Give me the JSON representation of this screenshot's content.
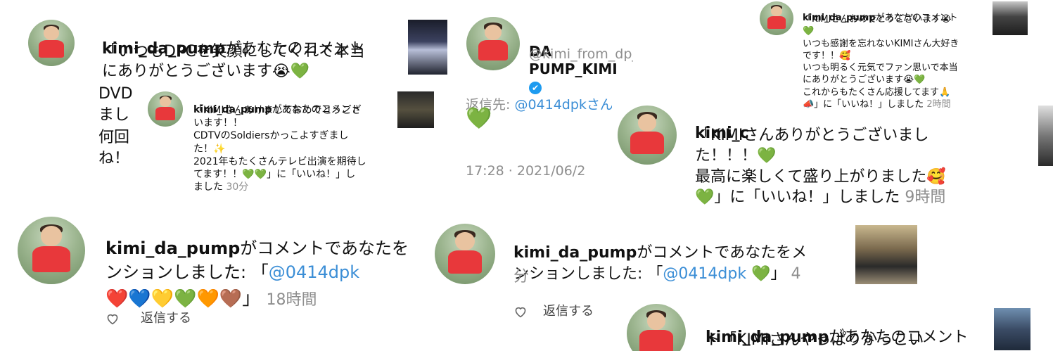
{
  "card1": {
    "username": "kimi_da_pump",
    "line1_rest": "があなたのコメント",
    "line2": "「いつもDPCを笑顔にしてくれて本当",
    "line3": "にありがとうございます😭💚",
    "line4": "DVD",
    "line5": "まし",
    "line6": "何回",
    "line7": "ね！"
  },
  "card2": {
    "username": "kimi_da_pump",
    "line1_rest": "があなたのコメント",
    "body": "「KIMIさんあけましておめでとうござ\nいます！！\nCDTVのSoldiersかっこよすぎまし\nた！✨\n2021年もたくさんテレビ出演を期待し\nてます！！💚💚」に「いいね！」し\nました",
    "time": "30分"
  },
  "card3": {
    "username": "kimi_da_pump",
    "line1_rest": "がコメントであなたを",
    "line2_pre": "ンションしました: 「",
    "mention": "@0414dpk",
    "hearts": "❤️💙💛💚🧡🤎",
    "close": "」",
    "time": "18時間",
    "reply": "返信する"
  },
  "card4": {
    "display_name": "DA PUMP_KIMI",
    "verified": "✔",
    "handle": "@kimi_from_dp_kz",
    "reply_to_label": "返信先: ",
    "reply_to": "@0414dpkさん",
    "body": "💚",
    "timestamp": "17:28 · 2021/06/2"
  },
  "card5": {
    "username": "kimi_da_pump",
    "line1_rest": "があなたのコメント",
    "body": "「KIMIさんおめでとうございます😭\n💚\nいつも感謝を忘れないKIMIさん大好き\nです！！🥰\nいつも明るく元気でファン思いで本当\nにありがとうございます😭💚\nこれからもたくさん応援してます🙏\n📣」に「いいね！」しました",
    "time": "2時間"
  },
  "card6": {
    "username": "kimi_c",
    "body": "「KIMIさんありがとうございまし\nた！！！💚\n最高に楽しくて盛り上がりました🥰\n💚」に「いいね！」しました",
    "time": "9時間"
  },
  "card7": {
    "username": "kimi_da_pump",
    "line1_rest": "がコメントであなたをメ",
    "line2_pre": "ンションしました: 「",
    "mention": "@0414dpk",
    "heart": "💚",
    "close": "」",
    "time_part1": "4",
    "time_part2": "分",
    "reply": "返信する"
  },
  "card8": {
    "username": "kimi_da_pump",
    "line1_rest": "があなたのコメント",
    "line2": "ト「KIMIさんやっぱりかっこい"
  },
  "colors": {
    "link": "#3b8ed6",
    "muted": "#8e8e8e",
    "verified": "#1d9bf0"
  }
}
